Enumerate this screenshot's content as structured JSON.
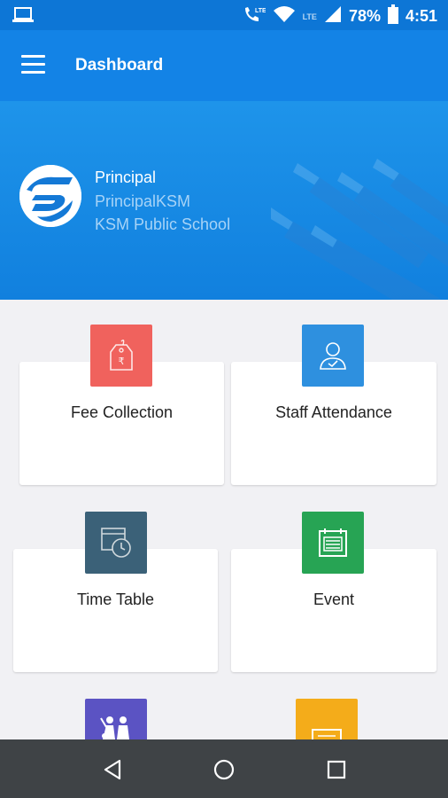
{
  "status_bar": {
    "lte_label": "LTE",
    "battery": "78%",
    "time": "4:51"
  },
  "app_bar": {
    "title": "Dashboard"
  },
  "profile": {
    "role": "Principal",
    "username": "PrincipalKSM",
    "school": "KSM Public School"
  },
  "tiles": [
    {
      "label": "Fee Collection",
      "icon": "fee-tag-icon",
      "color": "#f0625d"
    },
    {
      "label": "Staff Attendance",
      "icon": "staff-user-icon",
      "color": "#2e90df"
    },
    {
      "label": "Time Table",
      "icon": "timetable-clock-icon",
      "color": "#3b6178"
    },
    {
      "label": "Event",
      "icon": "event-notice-icon",
      "color": "#27a454"
    },
    {
      "label": "",
      "icon": "students-group-icon",
      "color": "#5b53c3"
    },
    {
      "label": "",
      "icon": "document-icon",
      "color": "#f4ac1a"
    }
  ],
  "colors": {
    "status_bar": "#0d76d6",
    "app_bar": "#1383e6",
    "header": "#1a8be4",
    "background": "#f1f1f4",
    "nav_bar": "#3f4346"
  }
}
